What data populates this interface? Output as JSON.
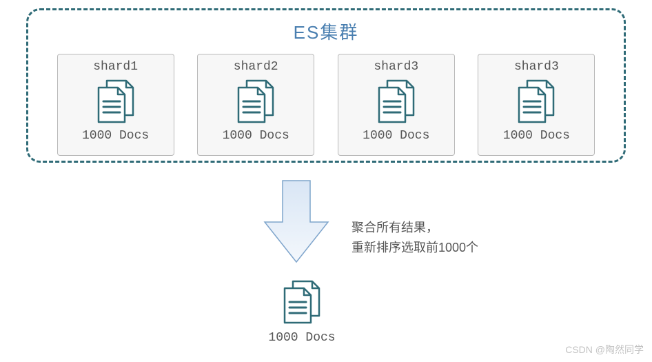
{
  "cluster": {
    "title": "ES集群",
    "shards": [
      {
        "label": "shard1",
        "count": "1000 Docs"
      },
      {
        "label": "shard2",
        "count": "1000 Docs"
      },
      {
        "label": "shard3",
        "count": "1000 Docs"
      },
      {
        "label": "shard3",
        "count": "1000 Docs"
      }
    ]
  },
  "annotation": {
    "line1": "聚合所有结果，",
    "line2": "重新排序选取前1000个"
  },
  "result": {
    "count": "1000 Docs"
  },
  "watermark": "CSDN @陶然同学"
}
